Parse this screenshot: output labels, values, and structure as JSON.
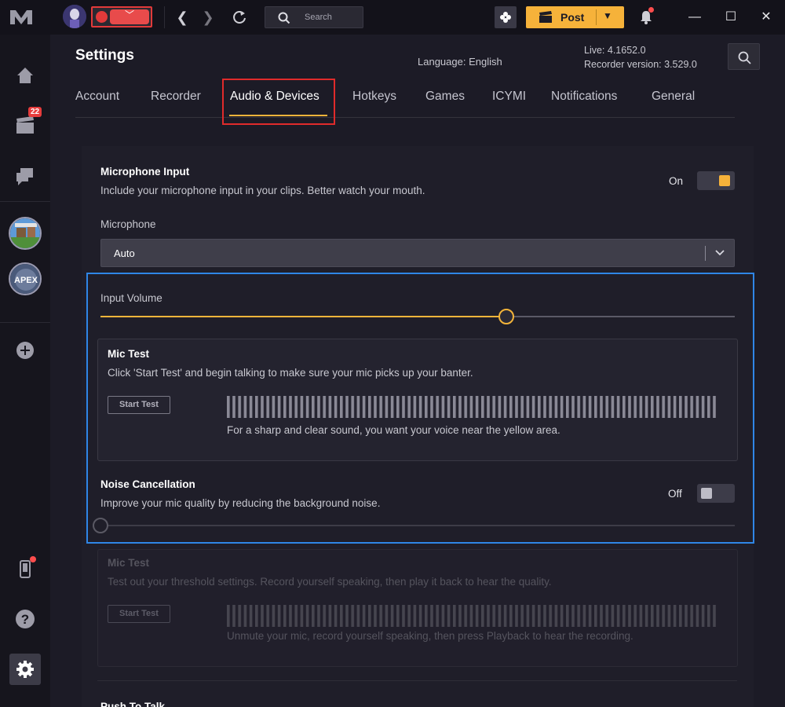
{
  "titlebar": {
    "search_placeholder": "Search",
    "post_label": "Post"
  },
  "sidebar": {
    "clips_badge": "22",
    "games": [
      "Minecraft",
      "Apex Legends"
    ]
  },
  "header": {
    "title": "Settings",
    "language": "Language: English",
    "live_version": "Live: 4.1652.0",
    "recorder_version": "Recorder version: 3.529.0"
  },
  "tabs": [
    {
      "label": "Account"
    },
    {
      "label": "Recorder"
    },
    {
      "label": "Audio & Devices",
      "active": true
    },
    {
      "label": "Hotkeys"
    },
    {
      "label": "Games"
    },
    {
      "label": "ICYMI"
    },
    {
      "label": "Notifications"
    },
    {
      "label": "General"
    }
  ],
  "microphone_input": {
    "title": "Microphone Input",
    "description": "Include your microphone input in your clips. Better watch your mouth.",
    "state": "On"
  },
  "microphone": {
    "label": "Microphone",
    "selected": "Auto"
  },
  "input_volume": {
    "label": "Input Volume",
    "level_fraction": 0.64
  },
  "mic_test": {
    "title": "Mic Test",
    "description": "Click 'Start Test' and begin talking to make sure your mic picks up your banter.",
    "button": "Start Test",
    "hint": "For a sharp and clear sound, you want your voice near the yellow area."
  },
  "noise_cancellation": {
    "title": "Noise Cancellation",
    "description": "Improve your mic quality by reducing the background noise.",
    "state": "Off",
    "level_fraction": 0.0
  },
  "mic_test_2": {
    "title": "Mic Test",
    "description": "Test out your threshold settings. Record yourself speaking, then play it back to hear the quality.",
    "button": "Start Test",
    "hint": "Unmute your mic, record yourself speaking, then press Playback to hear the recording."
  },
  "push_to_talk": {
    "title": "Push To Talk"
  },
  "colors": {
    "accent": "#f3b43a",
    "toggle_on_knob": "#f6b23a",
    "toggle_off_knob": "#bdbcc6",
    "focus_outline": "#2f86e6",
    "tab_outline": "#e02b2b"
  }
}
